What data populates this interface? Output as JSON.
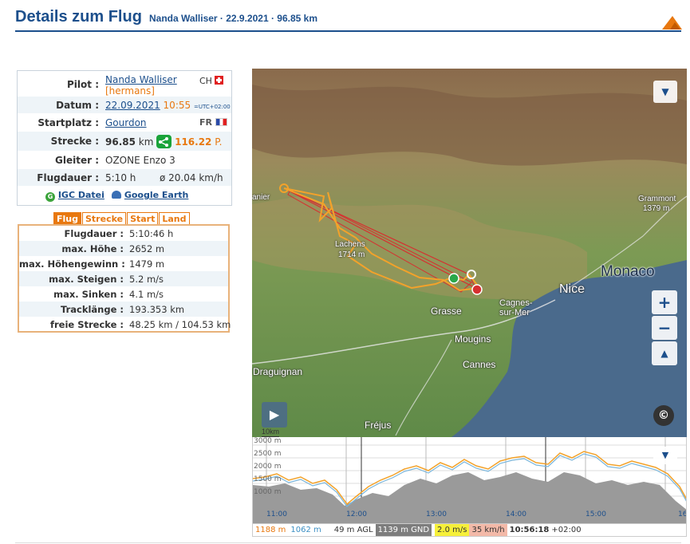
{
  "header": {
    "title": "Details zum Flug",
    "subtitle": "Nanda Walliser · 22.9.2021 · 96.85 km",
    "logo_icon": "mountain-logo-icon"
  },
  "pilot_card": {
    "pilot_label": "Pilot :",
    "pilot_name": "Nanda Walliser",
    "pilot_handle": "[hermans]",
    "pilot_country": "CH",
    "date_label": "Datum :",
    "date_value": "22.09.2021",
    "time_value": "10:55",
    "tz": "=UTC+02:00",
    "takeoff_label": "Startplatz :",
    "takeoff_value": "Gourdon",
    "takeoff_country": "FR",
    "distance_label": "Strecke :",
    "distance_value": "96.85",
    "distance_unit": "km",
    "points_value": "116.22",
    "points_unit": "P.",
    "glider_label": "Gleiter :",
    "glider_value": "OZONE Enzo 3",
    "duration_label": "Flugdauer :",
    "duration_value": "5:10 h",
    "avg_speed": "ø 20.04 km/h",
    "igc_label": "IGC Datei",
    "google_earth_label": "Google Earth"
  },
  "tabs": [
    {
      "label": "Flug",
      "active": true
    },
    {
      "label": "Strecke",
      "active": false
    },
    {
      "label": "Start",
      "active": false
    },
    {
      "label": "Land",
      "active": false
    }
  ],
  "stats": [
    {
      "label": "Flugdauer :",
      "value": "5:10:46 h"
    },
    {
      "label": "max. Höhe :",
      "value": "2652 m"
    },
    {
      "label": "max. Höhengewinn :",
      "value": "1479 m"
    },
    {
      "label": "max. Steigen :",
      "value": "5.2 m/s"
    },
    {
      "label": "max. Sinken :",
      "value": "4.1 m/s"
    },
    {
      "label": "Tracklänge :",
      "value": "193.353 km"
    },
    {
      "label": "freie Strecke :",
      "value": "48.25 km / 104.53 km"
    }
  ],
  "map": {
    "places": {
      "monaco": "Monaco",
      "nice": "Nice",
      "cagnes": "Cagnes-sur-Mer",
      "grasse": "Grasse",
      "mougins": "Mougins",
      "cannes": "Cannes",
      "draguignan": "Draguignan",
      "frejus": "Fréjus",
      "lachens": "Lachens",
      "lachens_alt": "1714 m",
      "grammont": "Grammont",
      "grammont_alt": "1379 m",
      "left_edge": "anier"
    },
    "scale_label": "10km",
    "zoom_in": "+",
    "zoom_out": "−",
    "north": "▲",
    "copyright": "©",
    "play_icon": "play-icon",
    "layers_icon": "chevron-down-icon"
  },
  "profile": {
    "alt_labels": [
      "3000 m",
      "2500 m",
      "2000 m",
      "1500 m",
      "1000 m"
    ],
    "time_labels": [
      "11:00",
      "12:00",
      "13:00",
      "14:00",
      "15:00",
      "16"
    ]
  },
  "status": {
    "alt": "1188 m",
    "gnd": "1062 m",
    "agl": "49 m AGL",
    "gnd_alt": "1139 m GND",
    "vario": "2.0 m/s",
    "speed": "35 km/h",
    "time": "10:56:18",
    "tz": "+02:00"
  },
  "colors": {
    "brand_blue": "#1c4f8c",
    "accent_orange": "#e8780f",
    "sea": "#4a6a8c"
  }
}
